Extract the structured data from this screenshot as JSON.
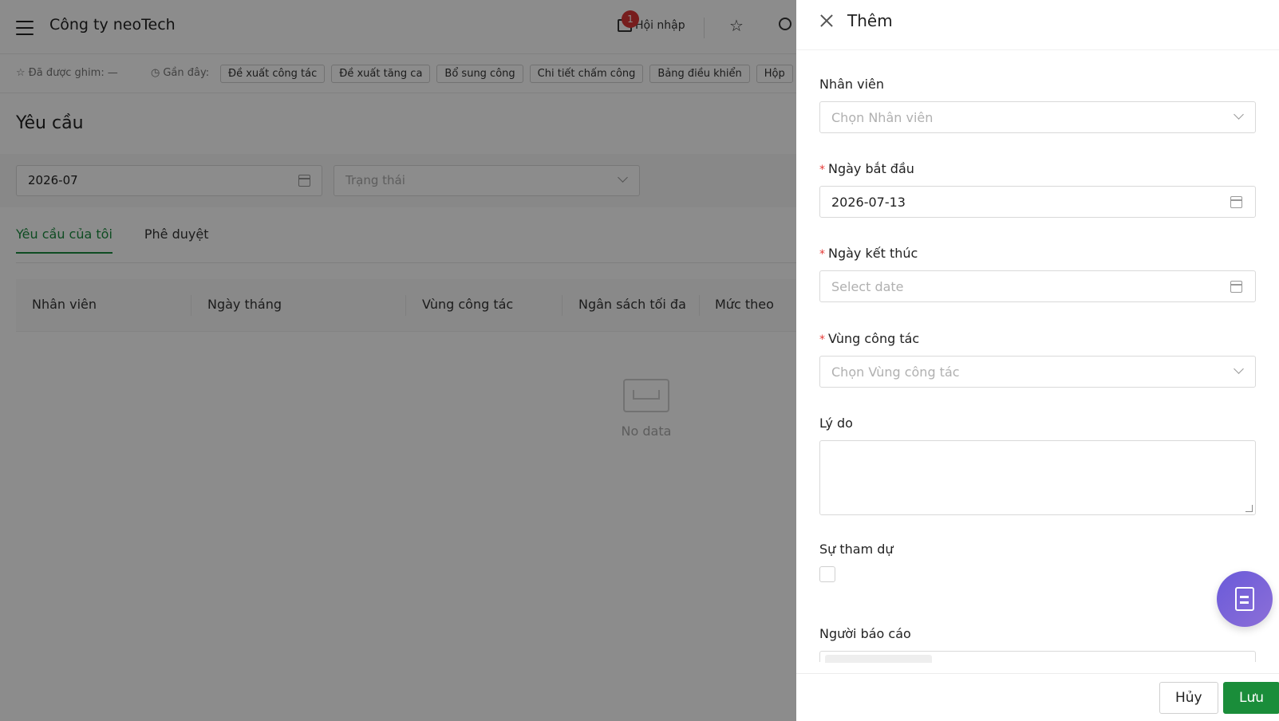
{
  "topbar": {
    "company": "Công ty neoTech",
    "notification_count": "1",
    "integration_label": "Hội nhập"
  },
  "recentbar": {
    "pinned_label": "Đã được ghim:",
    "pinned_value": "—",
    "recent_label": "Gần đây:",
    "chips": [
      "Đề xuất công tác",
      "Đề xuất tăng ca",
      "Bổ sung công",
      "Chi tiết chấm công",
      "Bảng điều khiển",
      "Hộp"
    ]
  },
  "page": {
    "title": "Yêu cầu",
    "filter_date": "2026-07",
    "filter_status_placeholder": "Trạng thái",
    "tabs": [
      "Yêu cầu của tôi",
      "Phê duyệt"
    ],
    "columns": [
      "Nhân viên",
      "Ngày tháng",
      "Vùng công tác",
      "Ngân sách tối đa",
      "Mức theo"
    ],
    "empty_text": "No data"
  },
  "drawer": {
    "title": "Thêm",
    "fields": {
      "employee_label": "Nhân viên",
      "employee_placeholder": "Chọn Nhân viên",
      "start_label": "Ngày bắt đầu",
      "start_value": "2026-07-13",
      "end_label": "Ngày kết thúc",
      "end_placeholder": "Select date",
      "region_label": "Vùng công tác",
      "region_placeholder": "Chọn Vùng công tác",
      "reason_label": "Lý do",
      "attend_label": "Sự tham dự",
      "reporter_label": "Người báo cáo"
    },
    "cancel_label": "Hủy",
    "save_label": "Lưu"
  },
  "colors": {
    "accent": "#1b8a3e",
    "required": "#e53935",
    "fab": "#7b66d9",
    "badge": "#d93636"
  }
}
